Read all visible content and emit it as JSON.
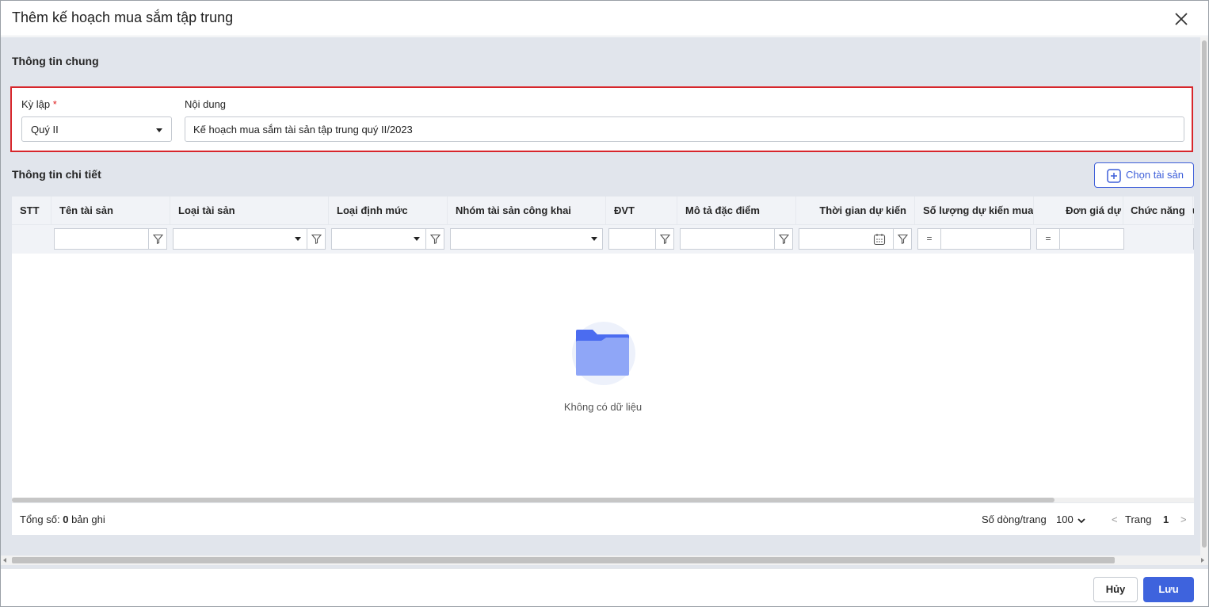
{
  "dialog": {
    "title": "Thêm kế hoạch mua sắm tập trung"
  },
  "general": {
    "section_title": "Thông tin chung",
    "period_label": "Kỳ lập",
    "required_mark": "*",
    "period_value": "Quý II",
    "content_label": "Nội dung",
    "content_value": "Kế hoạch mua sắm tài sản tập trung quý II/2023"
  },
  "detail": {
    "section_title": "Thông tin chi tiết",
    "add_button_label": "Chọn tài sản",
    "columns": [
      "STT",
      "Tên tài sản",
      "Loại tài sản",
      "Loại định mức",
      "Nhóm tài sản công khai",
      "ĐVT",
      "Mô tả đặc điểm",
      "Thời gian dự kiến",
      "Số lượng dự kiến mua",
      "Đơn giá dự",
      "Chức năng",
      "ức"
    ],
    "filter_eq_symbol": "=",
    "empty_text": "Không có dữ liệu"
  },
  "footer": {
    "total_prefix": "Tổng số:",
    "total_count": "0",
    "total_suffix": "bản ghi",
    "rows_per_page_label": "Số dòng/trang",
    "rows_per_page_value": "100",
    "prev_symbol": "<",
    "page_label": "Trang",
    "page_number": "1",
    "next_symbol": ">"
  },
  "actions": {
    "cancel_label": "Hủy",
    "save_label": "Lưu"
  },
  "colors": {
    "accent": "#3e63dd",
    "highlight_border": "#d7262b",
    "folder_blue": "#4b6cf0",
    "folder_light": "#8fa6f7"
  }
}
